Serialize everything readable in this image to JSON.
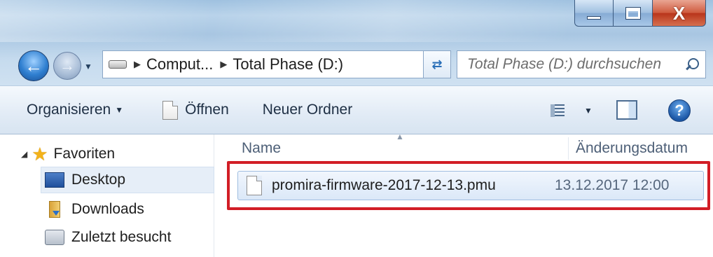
{
  "window": {
    "min_label": "",
    "max_label": "",
    "close_label": "X"
  },
  "address": {
    "crumbs": [
      "Comput...",
      "Total Phase (D:)"
    ]
  },
  "search": {
    "placeholder": "Total Phase (D:) durchsuchen"
  },
  "toolbar": {
    "organize": "Organisieren",
    "open": "Öffnen",
    "new_folder": "Neuer Ordner"
  },
  "sidebar": {
    "favorites": "Favoriten",
    "items": [
      {
        "label": "Desktop"
      },
      {
        "label": "Downloads"
      },
      {
        "label": "Zuletzt besucht"
      }
    ]
  },
  "columns": {
    "name": "Name",
    "date": "Änderungsdatum"
  },
  "files": [
    {
      "name": "promira-firmware-2017-12-13.pmu",
      "date": "13.12.2017 12:00"
    }
  ],
  "colors": {
    "highlight": "#d21e26",
    "selection": "#dbe8f8"
  }
}
